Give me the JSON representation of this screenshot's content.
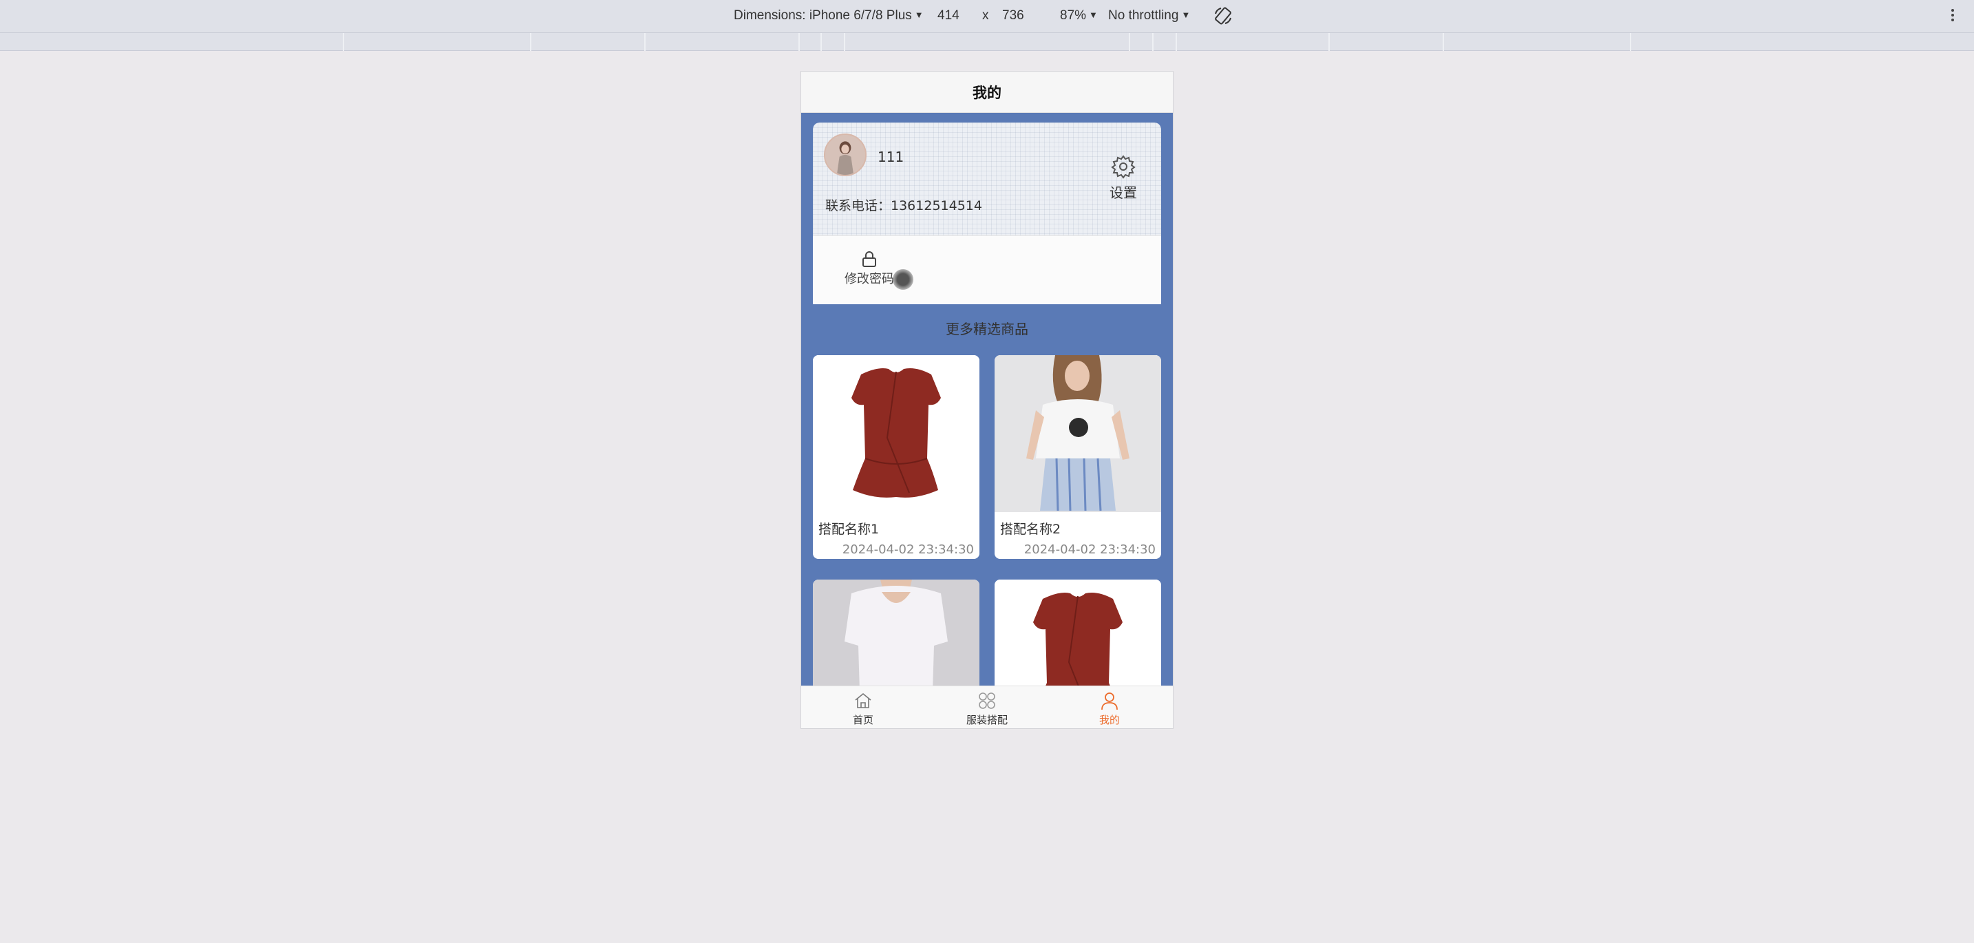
{
  "devtools": {
    "dimensions_label": "Dimensions: iPhone 6/7/8 Plus",
    "width_value": "414",
    "times": "x",
    "height_value": "736",
    "zoom": "87%",
    "throttling": "No throttling"
  },
  "header": {
    "title": "我的"
  },
  "profile": {
    "username": "111",
    "phone_label": "联系电话：13612514514",
    "settings_label": "设置"
  },
  "actions": {
    "change_password": "修改密码"
  },
  "section": {
    "title": "更多精选商品"
  },
  "products": [
    {
      "name": "搭配名称1",
      "time": "2024-04-02 23:34:30"
    },
    {
      "name": "搭配名称2",
      "time": "2024-04-02 23:34:30"
    },
    {
      "name": "",
      "time": ""
    },
    {
      "name": "",
      "time": ""
    }
  ],
  "tabbar": {
    "tabs": [
      {
        "label": "首页",
        "icon": "home-icon"
      },
      {
        "label": "服装搭配",
        "icon": "grid-icon"
      },
      {
        "label": "我的",
        "icon": "user-icon"
      }
    ],
    "active_color": "#ec6b2b"
  },
  "colors": {
    "page_bg": "#5a7ab6",
    "devtools_bg": "#dfe1e8"
  }
}
